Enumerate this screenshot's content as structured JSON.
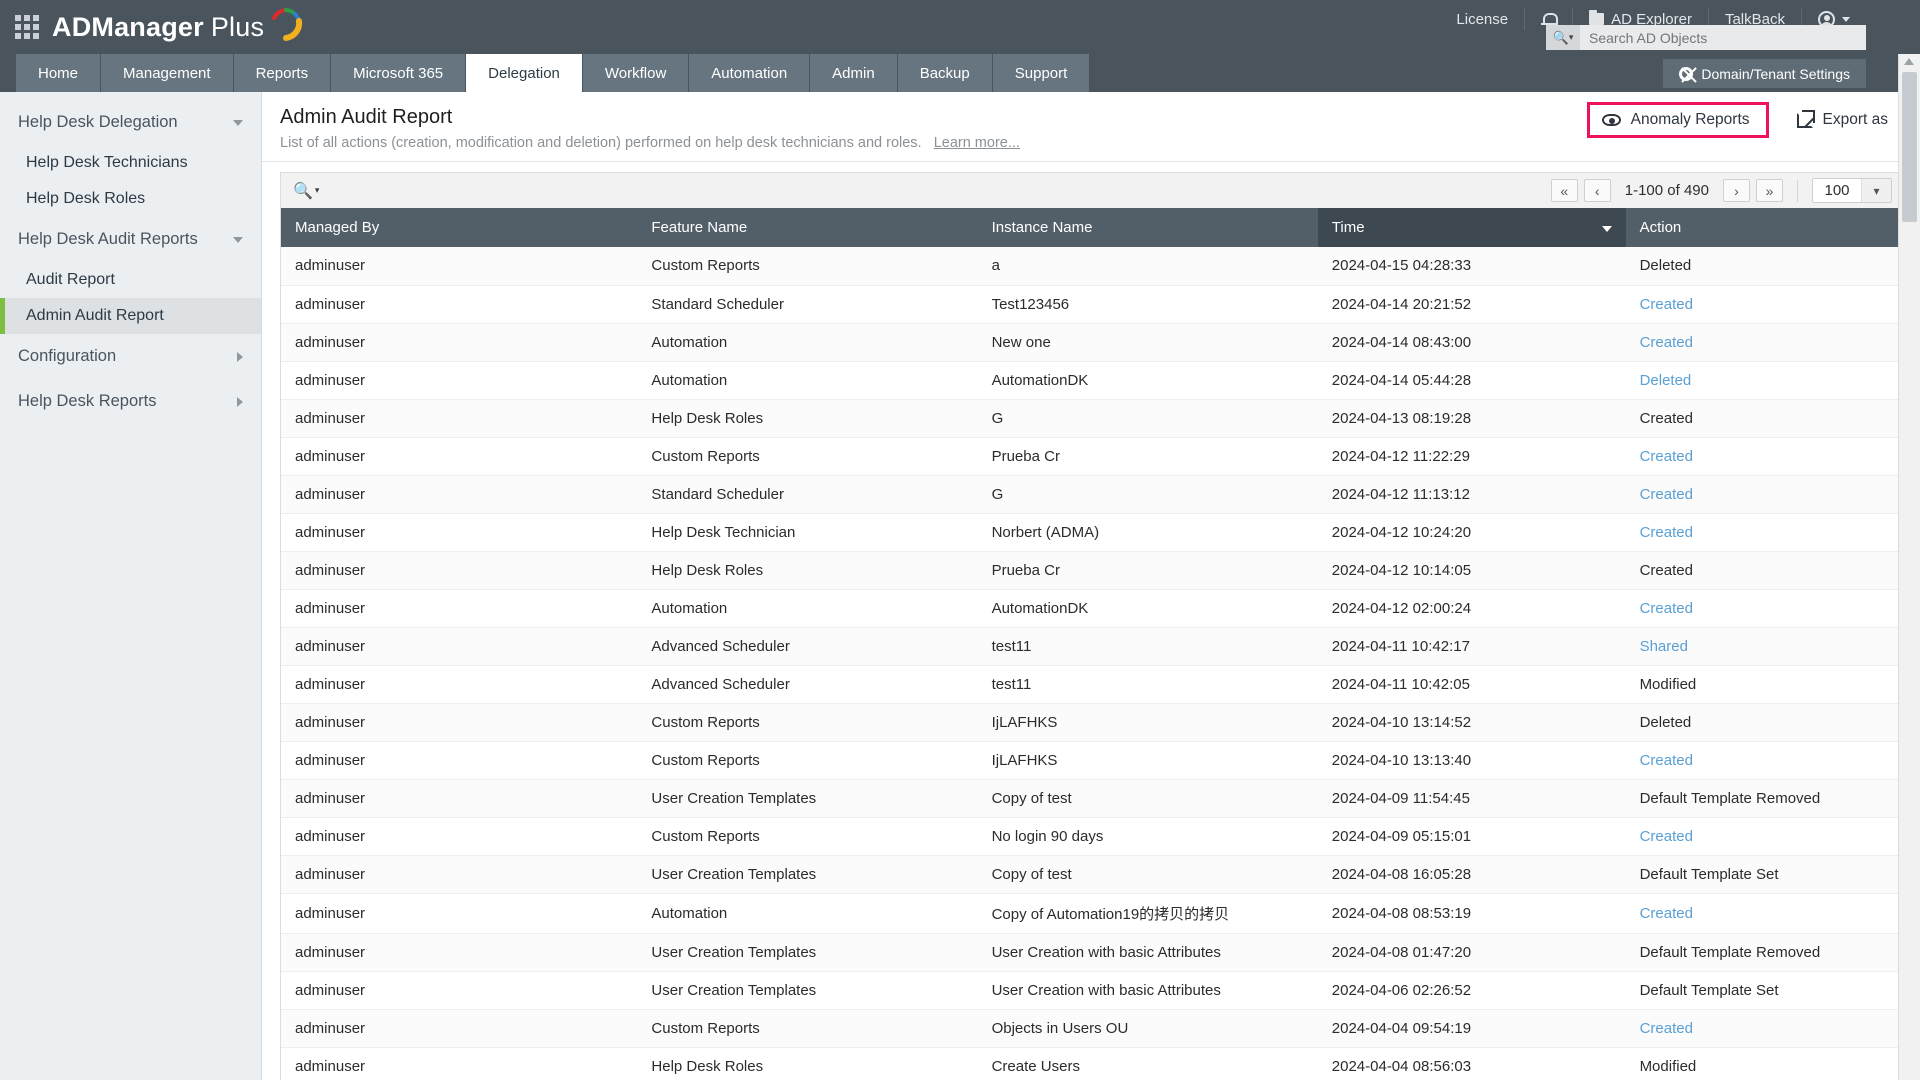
{
  "brand": {
    "name": "ADManager",
    "suffix": "Plus",
    "waffle_icon": "grid-apps-icon"
  },
  "topbar": {
    "license": "License",
    "notifications_icon": "bell-icon",
    "ad_explorer": "AD Explorer",
    "talkback": "TalkBack",
    "account_icon": "user-account-icon",
    "search": {
      "placeholder": "Search AD Objects",
      "value": "",
      "icon": "search-icon"
    }
  },
  "nav": {
    "tabs": [
      {
        "label": "Home",
        "active": false
      },
      {
        "label": "Management",
        "active": false
      },
      {
        "label": "Reports",
        "active": false
      },
      {
        "label": "Microsoft 365",
        "active": false
      },
      {
        "label": "Delegation",
        "active": true
      },
      {
        "label": "Workflow",
        "active": false
      },
      {
        "label": "Automation",
        "active": false
      },
      {
        "label": "Admin",
        "active": false
      },
      {
        "label": "Backup",
        "active": false
      },
      {
        "label": "Support",
        "active": false
      }
    ],
    "domain_tenant_settings": "Domain/Tenant Settings",
    "domain_tenant_icon": "gear-icon"
  },
  "sidebar": {
    "groups": [
      {
        "label": "Help Desk Delegation",
        "chevron": "chevron-down-icon"
      },
      {
        "label": "Help Desk Audit Reports",
        "chevron": "chevron-down-icon"
      },
      {
        "label": "Configuration",
        "chevron": "chevron-right-icon"
      },
      {
        "label": "Help Desk Reports",
        "chevron": "chevron-right-icon"
      }
    ],
    "items": [
      {
        "label": "Help Desk Technicians",
        "selected": false
      },
      {
        "label": "Help Desk Roles",
        "selected": false
      },
      {
        "label": "Audit Report",
        "selected": false
      },
      {
        "label": "Admin Audit Report",
        "selected": true
      }
    ]
  },
  "page": {
    "title": "Admin Audit Report",
    "subtitle": "List of all actions (creation, modification and deletion) performed on help desk technicians and roles.",
    "learn_more": "Learn more...",
    "anomaly_reports": "Anomaly Reports",
    "anomaly_icon": "eye-icon",
    "export_as": "Export as",
    "export_icon": "export-external-link-icon"
  },
  "toolbar": {
    "search_icon": "search-column-icon",
    "first_page_icon": "«",
    "prev_page_icon": "‹",
    "next_page_icon": "›",
    "last_page_icon": "»",
    "range_label": "1-100 of 490",
    "page_size": "100",
    "page_size_caret": "chevron-down-icon"
  },
  "table": {
    "columns": [
      {
        "label": "Managed By",
        "sorted": false
      },
      {
        "label": "Feature Name",
        "sorted": false
      },
      {
        "label": "Instance Name",
        "sorted": false
      },
      {
        "label": "Time",
        "sorted": true,
        "sort_dir": "desc"
      },
      {
        "label": "Action",
        "sorted": false
      }
    ],
    "rows": [
      {
        "managed_by": "adminuser",
        "feature": "Custom Reports",
        "instance": "a",
        "time": "2024-04-15 04:28:33",
        "action": "Deleted",
        "action_link": false
      },
      {
        "managed_by": "adminuser",
        "feature": "Standard Scheduler",
        "instance": "Test123456",
        "time": "2024-04-14 20:21:52",
        "action": "Created",
        "action_link": true
      },
      {
        "managed_by": "adminuser",
        "feature": "Automation",
        "instance": "New one",
        "time": "2024-04-14 08:43:00",
        "action": "Created",
        "action_link": true
      },
      {
        "managed_by": "adminuser",
        "feature": "Automation",
        "instance": "AutomationDK",
        "time": "2024-04-14 05:44:28",
        "action": "Deleted",
        "action_link": true
      },
      {
        "managed_by": "adminuser",
        "feature": "Help Desk Roles",
        "instance": "G",
        "time": "2024-04-13 08:19:28",
        "action": "Created",
        "action_link": false
      },
      {
        "managed_by": "adminuser",
        "feature": "Custom Reports",
        "instance": "Prueba Cr",
        "time": "2024-04-12 11:22:29",
        "action": "Created",
        "action_link": true
      },
      {
        "managed_by": "adminuser",
        "feature": "Standard Scheduler",
        "instance": "G",
        "time": "2024-04-12 11:13:12",
        "action": "Created",
        "action_link": true
      },
      {
        "managed_by": "adminuser",
        "feature": "Help Desk Technician",
        "instance": "Norbert (ADMA)",
        "time": "2024-04-12 10:24:20",
        "action": "Created",
        "action_link": true
      },
      {
        "managed_by": "adminuser",
        "feature": "Help Desk Roles",
        "instance": "Prueba Cr",
        "time": "2024-04-12 10:14:05",
        "action": "Created",
        "action_link": false
      },
      {
        "managed_by": "adminuser",
        "feature": "Automation",
        "instance": "AutomationDK",
        "time": "2024-04-12 02:00:24",
        "action": "Created",
        "action_link": true
      },
      {
        "managed_by": "adminuser",
        "feature": "Advanced Scheduler",
        "instance": "test11",
        "time": "2024-04-11 10:42:17",
        "action": "Shared",
        "action_link": true
      },
      {
        "managed_by": "adminuser",
        "feature": "Advanced Scheduler",
        "instance": "test11",
        "time": "2024-04-11 10:42:05",
        "action": "Modified",
        "action_link": false
      },
      {
        "managed_by": "adminuser",
        "feature": "Custom Reports",
        "instance": "IjLAFHKS",
        "time": "2024-04-10 13:14:52",
        "action": "Deleted",
        "action_link": false
      },
      {
        "managed_by": "adminuser",
        "feature": "Custom Reports",
        "instance": "IjLAFHKS",
        "time": "2024-04-10 13:13:40",
        "action": "Created",
        "action_link": true
      },
      {
        "managed_by": "adminuser",
        "feature": "User Creation Templates",
        "instance": "Copy of test",
        "time": "2024-04-09 11:54:45",
        "action": "Default Template Removed",
        "action_link": false
      },
      {
        "managed_by": "adminuser",
        "feature": "Custom Reports",
        "instance": "No login 90 days",
        "time": "2024-04-09 05:15:01",
        "action": "Created",
        "action_link": true
      },
      {
        "managed_by": "adminuser",
        "feature": "User Creation Templates",
        "instance": "Copy of test",
        "time": "2024-04-08 16:05:28",
        "action": "Default Template Set",
        "action_link": false
      },
      {
        "managed_by": "adminuser",
        "feature": "Automation",
        "instance": "Copy of Automation19的拷贝的拷贝",
        "time": "2024-04-08 08:53:19",
        "action": "Created",
        "action_link": true
      },
      {
        "managed_by": "adminuser",
        "feature": "User Creation Templates",
        "instance": "User Creation with basic Attributes",
        "time": "2024-04-08 01:47:20",
        "action": "Default Template Removed",
        "action_link": false
      },
      {
        "managed_by": "adminuser",
        "feature": "User Creation Templates",
        "instance": "User Creation with basic Attributes",
        "time": "2024-04-06 02:26:52",
        "action": "Default Template Set",
        "action_link": false
      },
      {
        "managed_by": "adminuser",
        "feature": "Custom Reports",
        "instance": "Objects in Users OU",
        "time": "2024-04-04 09:54:19",
        "action": "Created",
        "action_link": true
      },
      {
        "managed_by": "adminuser",
        "feature": "Help Desk Roles",
        "instance": "Create Users",
        "time": "2024-04-04 08:56:03",
        "action": "Modified",
        "action_link": false
      }
    ]
  },
  "colors": {
    "highlight": "#ee1359",
    "header_dark": "#49545d",
    "table_header": "#535f68",
    "selected_sidebar_accent": "#7bc043",
    "link": "#5a9fd4"
  }
}
